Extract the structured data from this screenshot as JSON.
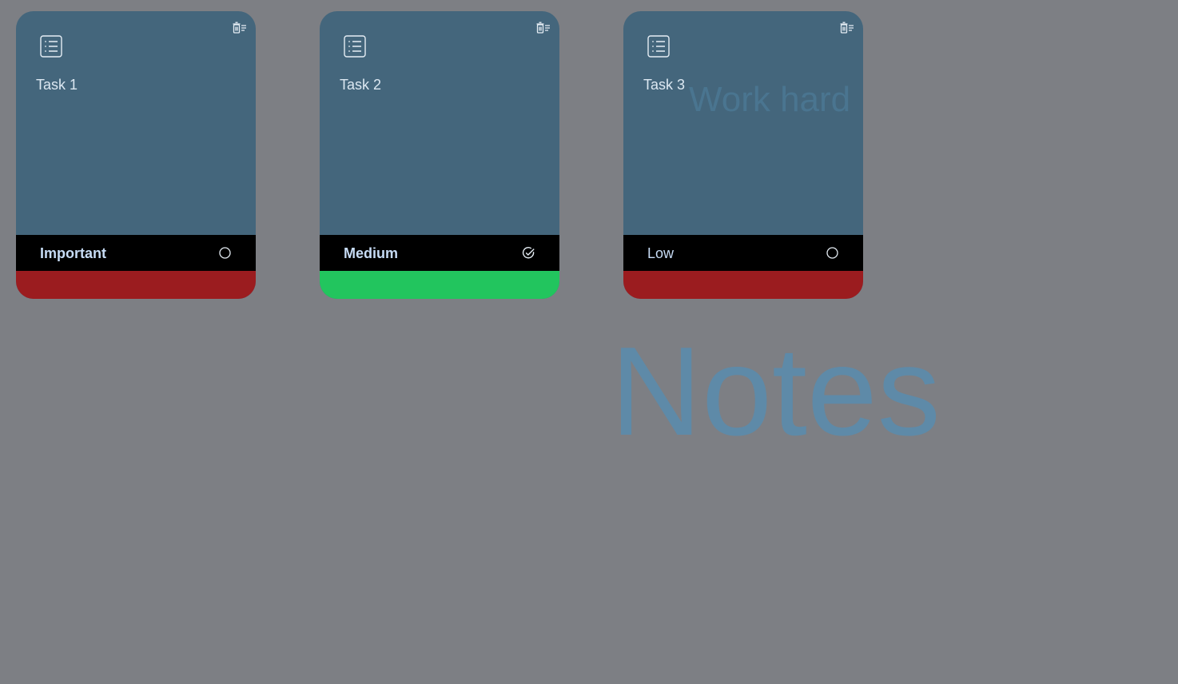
{
  "header": {
    "title": "Notes"
  },
  "colors": {
    "background": "#7d7f84",
    "card": "#44667c",
    "bar": "#000000",
    "title_accent": "#5e8aa8",
    "incomplete": "#9b1c1f",
    "complete": "#22c55e"
  },
  "cards": [
    {
      "title": "Task 1",
      "description": "",
      "priority": "Important",
      "status_icon": "circle-icon",
      "footer_color": "#9b1c1f"
    },
    {
      "title": "Task 2",
      "description": "",
      "priority": "Medium",
      "status_icon": "check-circle-icon",
      "footer_color": "#22c55e"
    },
    {
      "title": "Task 3",
      "description": "Work hard",
      "priority": "Low",
      "status_icon": "circle-icon",
      "footer_color": "#9b1c1f"
    }
  ]
}
